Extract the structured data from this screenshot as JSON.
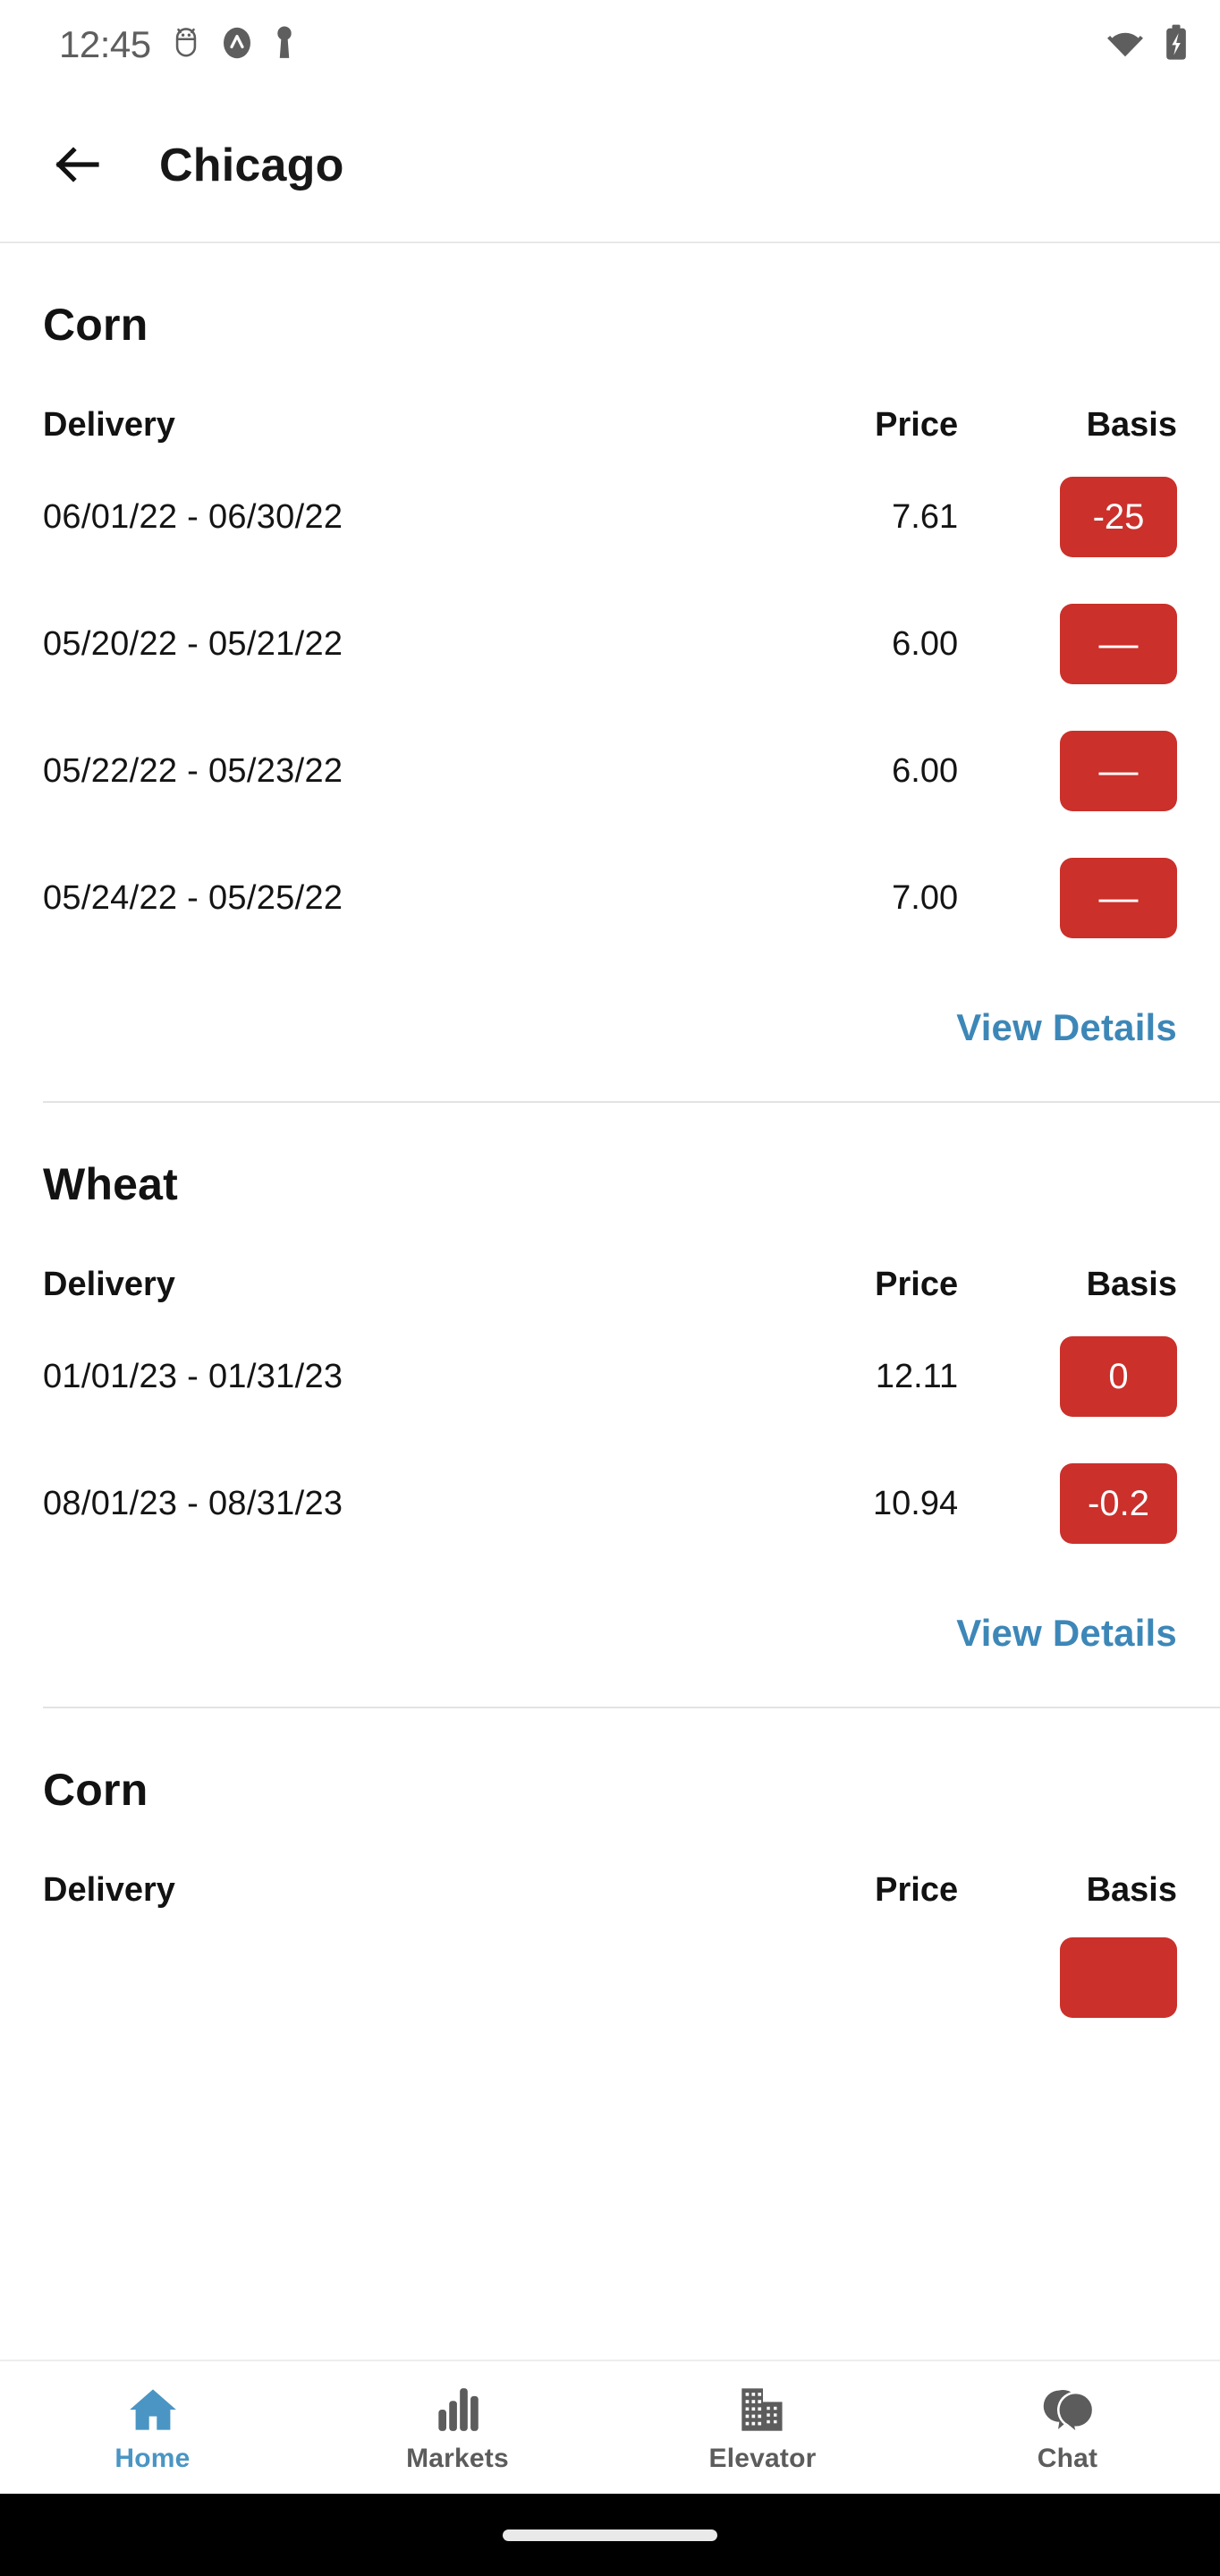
{
  "status_bar": {
    "time": "12:45",
    "icons_left": [
      "android-debug-icon",
      "app-badge-icon",
      "vpn-key-icon"
    ],
    "icons_right": [
      "wifi-icon",
      "battery-charging-icon"
    ]
  },
  "app_bar": {
    "back_icon": "arrow-left-icon",
    "title": "Chicago"
  },
  "colors": {
    "badge_red": "#cb302b",
    "link_blue": "#3d87b8",
    "nav_active": "#4a95c4",
    "nav_inactive": "#5c5c5c",
    "text_primary": "#121212",
    "divider": "#e3e3e3"
  },
  "table_headers": {
    "delivery": "Delivery",
    "price": "Price",
    "basis": "Basis"
  },
  "view_details_label": "View Details",
  "sections": [
    {
      "commodity": "Corn",
      "rows": [
        {
          "delivery": "06/01/22 - 06/30/22",
          "price": "7.61",
          "basis": "-25"
        },
        {
          "delivery": "05/20/22 - 05/21/22",
          "price": "6.00",
          "basis": "—"
        },
        {
          "delivery": "05/22/22 - 05/23/22",
          "price": "6.00",
          "basis": "—"
        },
        {
          "delivery": "05/24/22 - 05/25/22",
          "price": "7.00",
          "basis": "—"
        }
      ]
    },
    {
      "commodity": "Wheat",
      "rows": [
        {
          "delivery": "01/01/23 - 01/31/23",
          "price": "12.11",
          "basis": "0"
        },
        {
          "delivery": "08/01/23 - 08/31/23",
          "price": "10.94",
          "basis": "-0.2"
        }
      ]
    },
    {
      "commodity": "Corn",
      "rows": []
    }
  ],
  "bottom_nav": {
    "items": [
      {
        "label": "Home",
        "icon": "home-icon",
        "active": true
      },
      {
        "label": "Markets",
        "icon": "bar-chart-icon",
        "active": false
      },
      {
        "label": "Elevator",
        "icon": "building-icon",
        "active": false
      },
      {
        "label": "Chat",
        "icon": "chat-icon",
        "active": false
      }
    ]
  }
}
